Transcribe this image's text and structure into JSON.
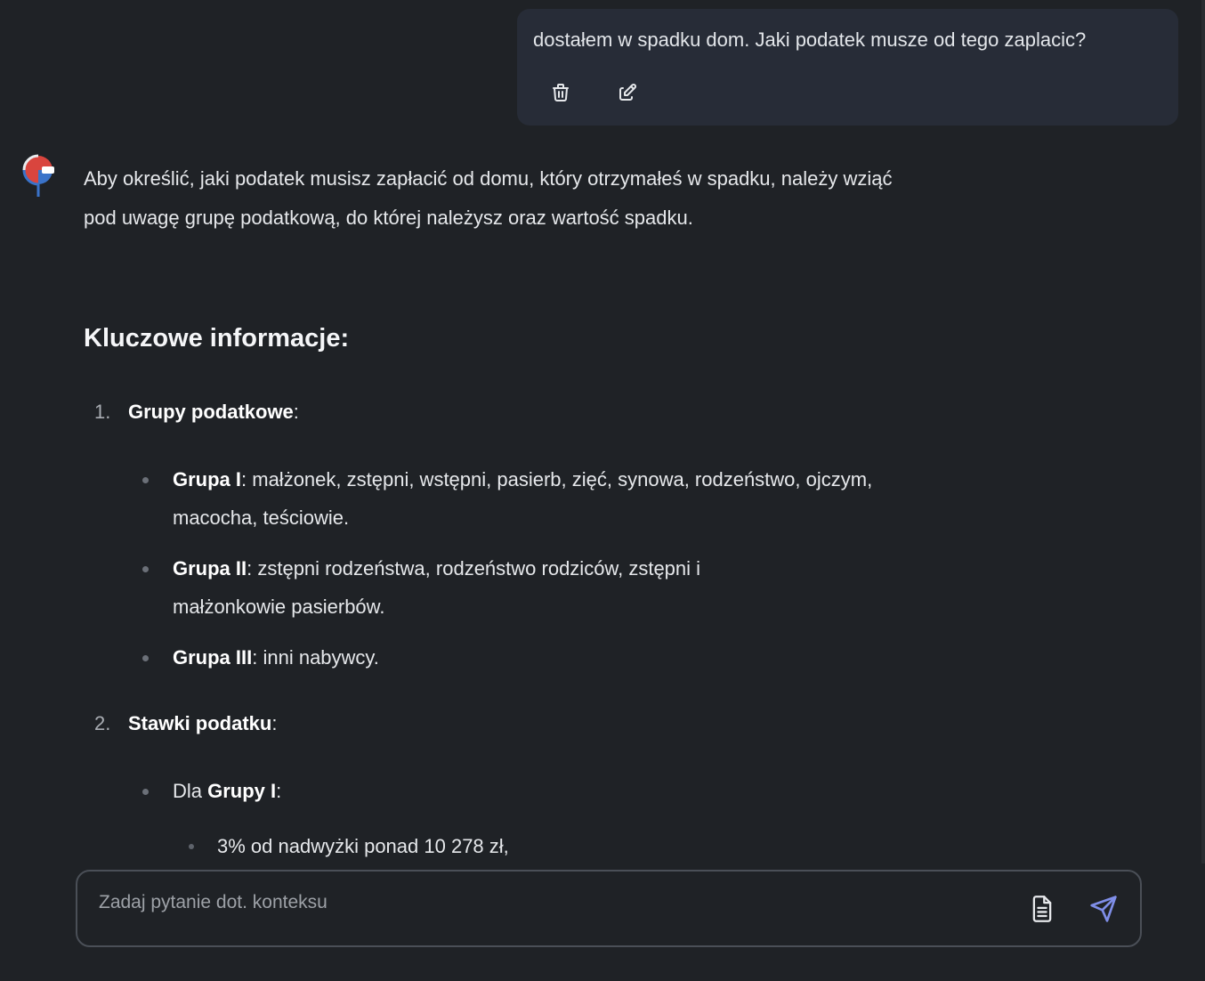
{
  "user_message": {
    "text": "dostałem w spadku dom. Jaki podatek musze od tego zaplacic?",
    "delete_icon": "trash-icon",
    "edit_icon": "edit-icon"
  },
  "assistant": {
    "avatar_icon": "assistant-logo-icon",
    "intro": "Aby określić, jaki podatek musisz zapłacić od domu, który otrzymałeś w spadku, należy wziąć pod uwagę grupę podatkową, do której należysz oraz wartość spadku.",
    "heading": "Kluczowe informacje:",
    "items": [
      {
        "number": "1.",
        "title": "Grupy podatkowe",
        "suffix": ":",
        "bullets": [
          {
            "bold": "Grupa I",
            "text": ": małżonek, zstępni, wstępni, pasierb, zięć, synowa, rodzeństwo, ojczym, macocha, teściowie."
          },
          {
            "bold": "Grupa II",
            "text": ": zstępni rodzeństwa, rodzeństwo rodziców, zstępni i małżonkowie pasierbów."
          },
          {
            "bold": "Grupa III",
            "text": ": inni nabywcy."
          }
        ]
      },
      {
        "number": "2.",
        "title": "Stawki podatku",
        "suffix": ":",
        "bullets": [
          {
            "prefix": "Dla ",
            "bold": "Grupy I",
            "text": ":"
          }
        ],
        "sub_bullets": [
          "3% od nadwyżki ponad 10 278 zł,"
        ]
      }
    ]
  },
  "input": {
    "placeholder": "Zadaj pytanie dot. konteksu",
    "attach_icon": "document-icon",
    "send_icon": "send-icon"
  },
  "colors": {
    "background": "#1f2226",
    "user_bubble": "#272c37",
    "send_accent": "#7f8ee8",
    "logo_red": "#d9453e",
    "logo_blue": "#3a73c9"
  }
}
